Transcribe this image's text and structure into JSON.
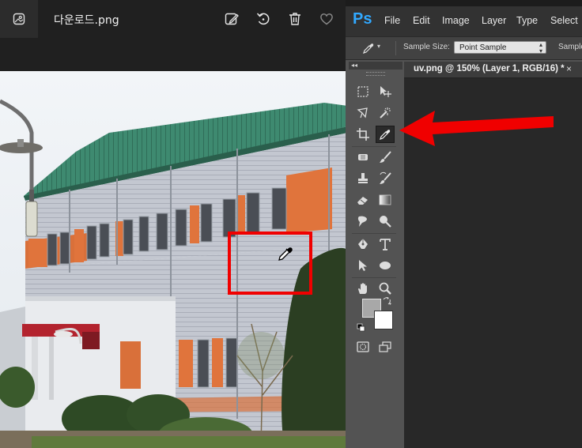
{
  "viewer": {
    "filename": "다운로드.png",
    "icons": [
      "photos-app-icon",
      "edit-image-icon",
      "rotate-icon",
      "delete-icon",
      "favorite-icon"
    ]
  },
  "photoshop": {
    "logo": "Ps",
    "menu": [
      "File",
      "Edit",
      "Image",
      "Layer",
      "Type",
      "Select"
    ],
    "options": {
      "sample_size_label": "Sample Size:",
      "sample_size_value": "Point Sample",
      "sample_truncated": "Sample"
    },
    "toolbar_collapse": "◂◂",
    "document_tab": "uv.png @ 150% (Layer 1, RGB/16) *",
    "close_tab": "×",
    "colors": {
      "foreground": "#a8a8a8",
      "background": "#ffffff"
    },
    "active_tool": "eyedropper-tool"
  },
  "annotations": {
    "highlight_color": "#f00000",
    "arrow_color": "#f00000"
  }
}
